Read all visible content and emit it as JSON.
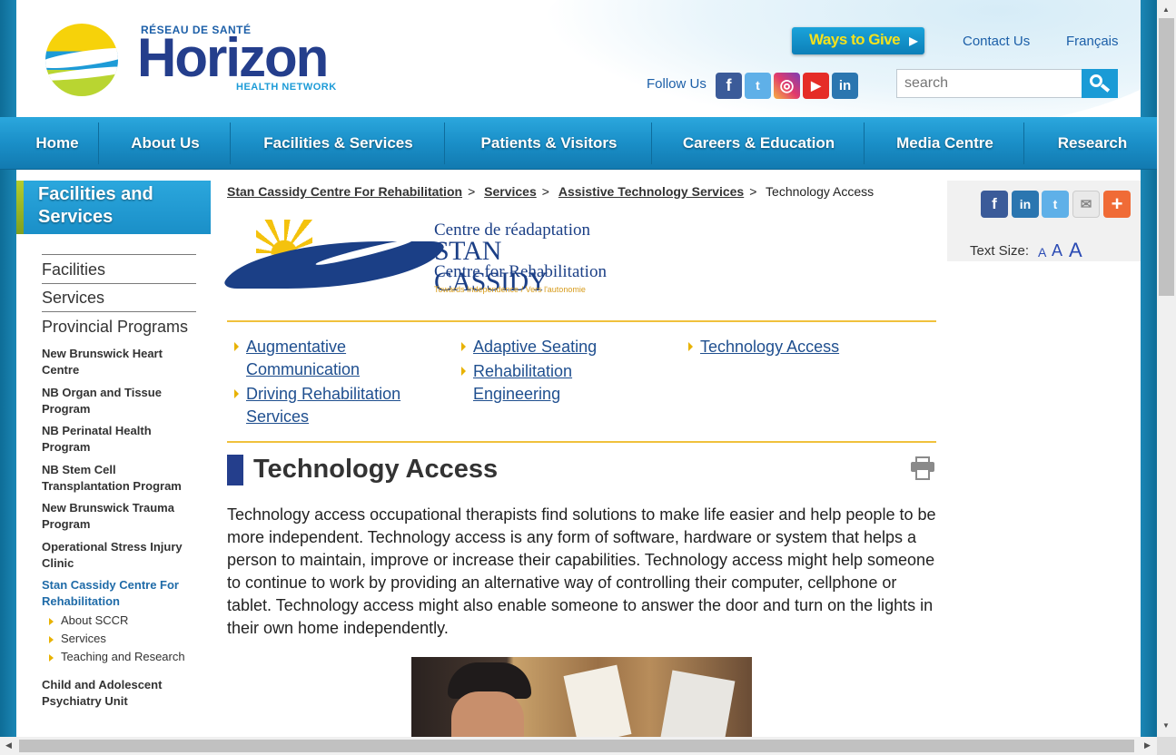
{
  "header": {
    "logo": {
      "reseau": "RÉSEAU DE SANTÉ",
      "name": "Horizon",
      "network": "HEALTH NETWORK"
    },
    "ways_to_give": "Ways to Give",
    "contact": "Contact Us",
    "francais": "Français",
    "follow_us": "Follow Us",
    "social": [
      "facebook-icon",
      "twitter-icon",
      "instagram-icon",
      "youtube-icon",
      "linkedin-icon"
    ],
    "search_placeholder": "search"
  },
  "nav": [
    "Home",
    "About Us",
    "Facilities & Services",
    "Patients & Visitors",
    "Careers & Education",
    "Media Centre",
    "Research"
  ],
  "sidebar": {
    "heading": "Facilities and Services",
    "main": [
      "Facilities",
      "Services",
      "Provincial Programs"
    ],
    "programs": [
      "New Brunswick Heart Centre",
      "NB Organ and Tissue Program",
      "NB Perinatal Health Program",
      "NB Stem Cell Transplantation Program",
      "New Brunswick Trauma Program",
      "Operational Stress Injury Clinic",
      "Stan Cassidy Centre For Rehabilitation"
    ],
    "sub_items": [
      "About SCCR",
      "Services",
      "Teaching and Research"
    ],
    "last_program": "Child and Adolescent Psychiatry Unit"
  },
  "breadcrumb": {
    "items": [
      "Stan Cassidy Centre For Rehabilitation",
      "Services",
      "Assistive Technology Services"
    ],
    "current": "Technology Access"
  },
  "sccr_logo": {
    "line1": "Centre de réadaptation",
    "line2": "STAN CASSIDY",
    "line3": "Centre for Rehabilitation",
    "tagline": "Towards Independence / Vers l'autonomie"
  },
  "service_links": {
    "augmentative": "Augmentative Communication",
    "driving": "Driving Rehabilitation Services",
    "adaptive": "Adaptive Seating",
    "rehab_eng": "Rehabilitation Engineering",
    "tech_access": "Technology Access"
  },
  "page": {
    "title": "Technology Access",
    "body": "Technology access occupational therapists find solutions to make life easier and help people to be more independent. Technology access is any form of software, hardware or system that helps a person to maintain, improve or increase their capabilities. Technology access might help someone to continue to work by providing an alternative way of controlling their computer, cellphone or tablet. Technology access might also enable someone to answer the door and turn on the lights in their own home independently."
  },
  "right_panel": {
    "share_icons": [
      "facebook-share-icon",
      "linkedin-share-icon",
      "twitter-share-icon",
      "email-share-icon",
      "plus-share-icon"
    ],
    "text_size_label": "Text Size:",
    "text_sizes": [
      "A",
      "A",
      "A"
    ]
  },
  "colors": {
    "brand_blue": "#243e8c",
    "nav_blue": "#1a8fc8",
    "accent_gold": "#f0c13c",
    "link_blue": "#1f4f8f"
  }
}
